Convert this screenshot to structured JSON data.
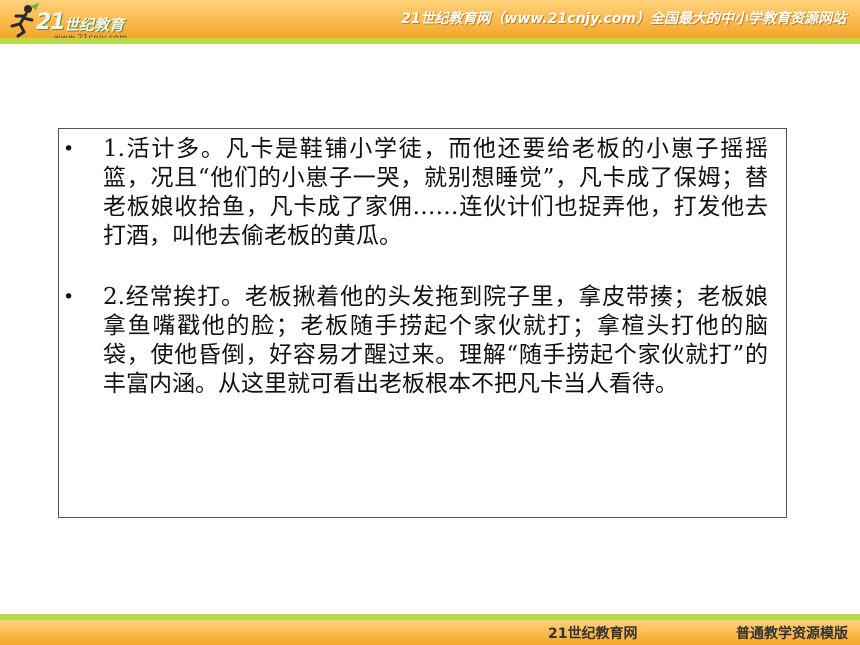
{
  "header": {
    "logo_number": "21",
    "logo_name": "世纪教育",
    "logo_url": "www.21cnjy.com",
    "slogan": "21世纪教育网（www.21cnjy.com）全国最大的中小学教育资源网站"
  },
  "content": {
    "items": [
      {
        "bullet": "•",
        "text": " 1.活计多。凡卡是鞋铺小学徒，而他还要给老板的小崽子摇摇篮，况且“他们的小崽子一哭，就别想睡觉”，凡卡成了保姆；替老板娘收拾鱼，凡卡成了家佣……连伙计们也捉弄他，打发他去打酒，叫他去偷老板的黄瓜。"
      },
      {
        "bullet": "•",
        "text": " 2.经常挨打。老板揪着他的头发拖到院子里，拿皮带揍；老板娘拿鱼嘴戳他的脸；老板随手捞起个家伙就打；拿楦头打他的脑袋，使他昏倒，好容易才醒过来。理解“随手捞起个家伙就打”的丰富内涵。从这里就可看出老板根本不把凡卡当人看待。"
      }
    ]
  },
  "footer": {
    "left": "21世纪教育网",
    "right": "普通教学资源模版"
  },
  "colors": {
    "header_orange": "#f4a62a",
    "accent_green": "#b9d84a"
  }
}
